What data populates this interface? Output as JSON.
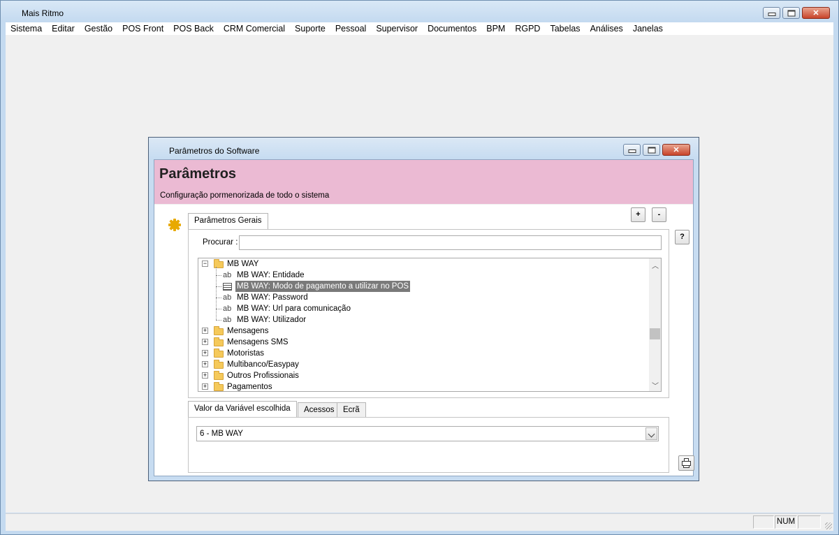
{
  "app": {
    "title": "Mais Ritmo",
    "menu": [
      "Sistema",
      "Editar",
      "Gestão",
      "POS Front",
      "POS Back",
      "CRM Comercial",
      "Suporte",
      "Pessoal",
      "Supervisor",
      "Documentos",
      "BPM",
      "RGPD",
      "Tabelas",
      "Análises",
      "Janelas"
    ]
  },
  "dialog": {
    "title": "Parâmetros do Software",
    "heading": "Parâmetros",
    "subtitle": "Configuração pormenorizada de todo o sistema",
    "add_label": "+",
    "remove_label": "-",
    "help_label": "?",
    "top_tab": "Parâmetros Gerais",
    "search_label": "Procurar :",
    "search_value": "",
    "tree": [
      {
        "label": "MB WAY",
        "type": "folder",
        "expanded": true,
        "level": 0
      },
      {
        "label": "MB WAY: Entidade",
        "type": "text",
        "level": 1
      },
      {
        "label": "MB WAY: Modo de pagamento a utilizar no POS",
        "type": "list",
        "level": 1,
        "selected": true
      },
      {
        "label": "MB WAY: Password",
        "type": "text",
        "level": 1
      },
      {
        "label": "MB WAY: Url para comunicação",
        "type": "text",
        "level": 1
      },
      {
        "label": "MB WAY: Utilizador",
        "type": "text",
        "level": 1
      },
      {
        "label": "Mensagens",
        "type": "folder",
        "expanded": false,
        "level": 0
      },
      {
        "label": "Mensagens SMS",
        "type": "folder",
        "expanded": false,
        "level": 0
      },
      {
        "label": "Motoristas",
        "type": "folder",
        "expanded": false,
        "level": 0
      },
      {
        "label": "Multibanco/Easypay",
        "type": "folder",
        "expanded": false,
        "level": 0
      },
      {
        "label": "Outros Profissionais",
        "type": "folder",
        "expanded": false,
        "level": 0
      },
      {
        "label": "Pagamentos",
        "type": "folder",
        "expanded": false,
        "level": 0
      }
    ],
    "bottom_tabs": [
      "Valor da Variável escolhida",
      "Acessos",
      "Ecrã"
    ],
    "selected_value": "6 - MB WAY",
    "text_icon_glyph": "ab"
  },
  "statusbar": {
    "cells": [
      "",
      "NUM",
      ""
    ]
  }
}
